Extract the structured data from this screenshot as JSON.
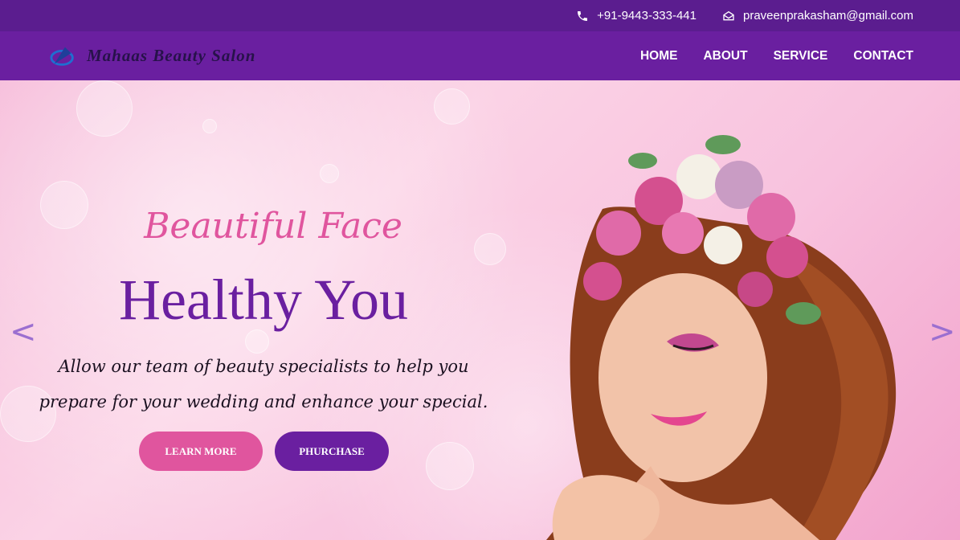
{
  "topbar": {
    "phone": "+91-9443-333-441",
    "email": "praveenprakasham@gmail.com"
  },
  "brand": {
    "name": "Mahaas Beauty Salon"
  },
  "nav": {
    "items": [
      "HOME",
      "ABOUT",
      "SERVICE",
      "CONTACT"
    ]
  },
  "hero": {
    "script_title": "Beautiful Face",
    "title": "Healthy You",
    "desc_line1": "Allow our team of beauty specialists to help you",
    "desc_line2": "prepare for your wedding and enhance your special.",
    "learn_more": "LEARN MORE",
    "purchase": "PHURCHASE",
    "prev": "<",
    "next": ">"
  },
  "icons": {
    "phone": "phone-icon",
    "email": "envelope-icon",
    "logo": "logo-icon"
  },
  "colors": {
    "topbar": "#5b1d8f",
    "navbar": "#6a1fa0",
    "accent_pink": "#e0559e",
    "accent_purple": "#6a1fa0"
  }
}
